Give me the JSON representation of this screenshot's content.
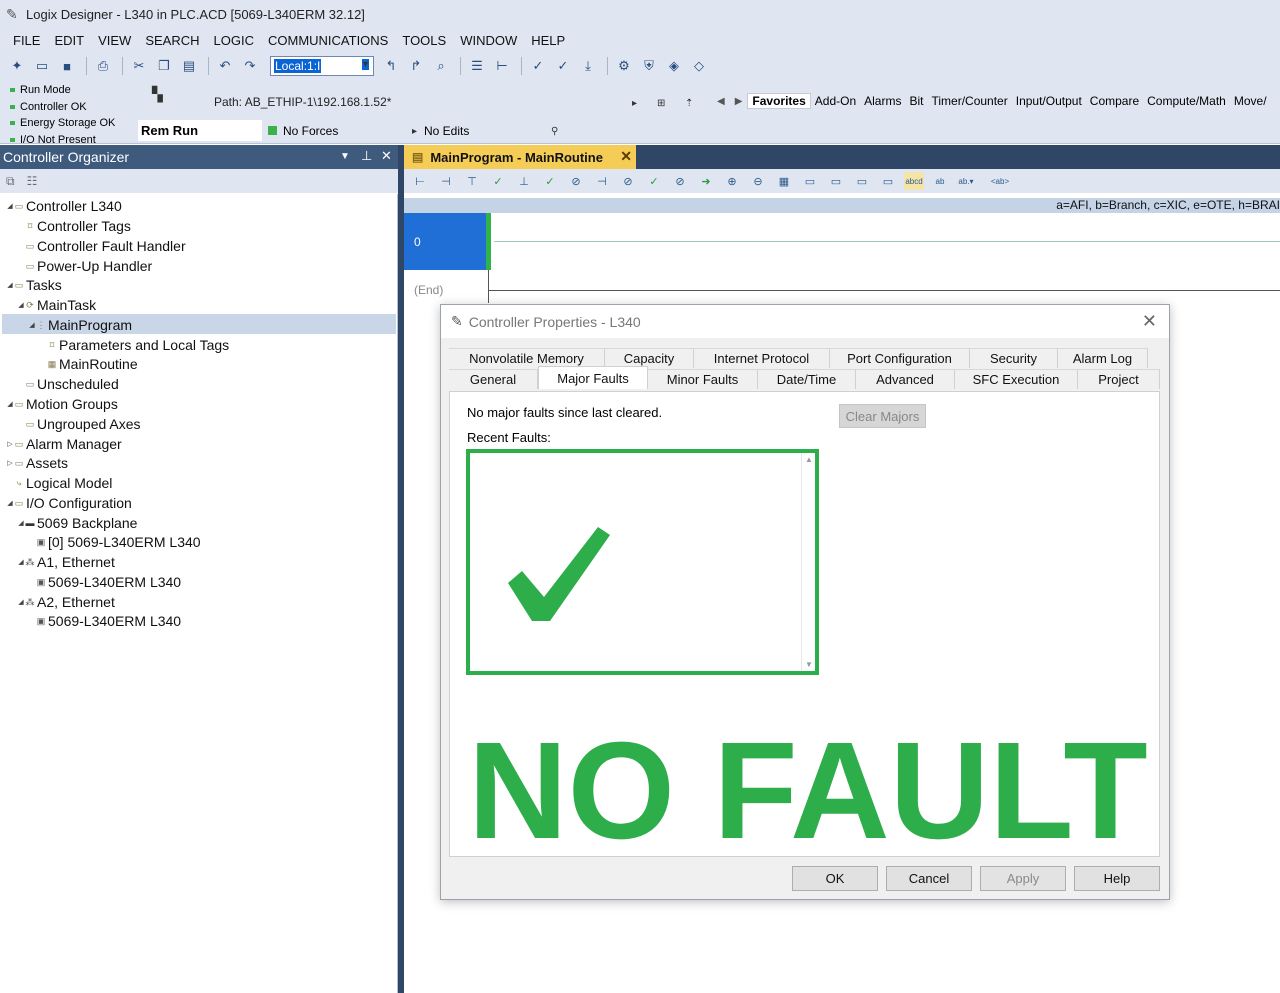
{
  "window": {
    "title": "Logix Designer - L340 in PLC.ACD [5069-L340ERM 32.12]"
  },
  "menu": [
    "FILE",
    "EDIT",
    "VIEW",
    "SEARCH",
    "LOGIC",
    "COMMUNICATIONS",
    "TOOLS",
    "WINDOW",
    "HELP"
  ],
  "toolbar": {
    "path_value": "Local:1:I"
  },
  "status": {
    "lines": [
      "Run Mode",
      "Controller OK",
      "Energy Storage OK",
      "I/O Not Present"
    ],
    "path": "Path: AB_ETHIP-1\\192.168.1.52*",
    "mode": "Rem Run",
    "forces": "No Forces",
    "edits": "No Edits"
  },
  "instruction_tabs": [
    "Favorites",
    "Add-On",
    "Alarms",
    "Bit",
    "Timer/Counter",
    "Input/Output",
    "Compare",
    "Compute/Math",
    "Move/"
  ],
  "organizer": {
    "title": "Controller Organizer",
    "items": [
      {
        "label": "Controller L340"
      },
      {
        "label": "Controller Tags"
      },
      {
        "label": "Controller Fault Handler"
      },
      {
        "label": "Power-Up Handler"
      },
      {
        "label": "Tasks"
      },
      {
        "label": "MainTask"
      },
      {
        "label": "MainProgram"
      },
      {
        "label": "Parameters and Local Tags"
      },
      {
        "label": "MainRoutine"
      },
      {
        "label": "Unscheduled"
      },
      {
        "label": "Motion Groups"
      },
      {
        "label": "Ungrouped Axes"
      },
      {
        "label": "Alarm Manager"
      },
      {
        "label": "Assets"
      },
      {
        "label": "Logical Model"
      },
      {
        "label": "I/O Configuration"
      },
      {
        "label": "5069 Backplane"
      },
      {
        "label": "[0] 5069-L340ERM L340"
      },
      {
        "label": "A1, Ethernet"
      },
      {
        "label": "5069-L340ERM L340"
      },
      {
        "label": "A2, Ethernet"
      },
      {
        "label": "5069-L340ERM L340"
      }
    ]
  },
  "routine": {
    "tab_title": "MainProgram - MainRoutine",
    "legend": "a=AFI, b=Branch, c=XIC, e=OTE, h=BRAI",
    "rung_number": "0",
    "end_label": "(End)"
  },
  "dialog": {
    "title": "Controller Properties - L340",
    "tabs_row1": [
      "Nonvolatile Memory",
      "Capacity",
      "Internet Protocol",
      "Port Configuration",
      "Security",
      "Alarm Log"
    ],
    "tabs_row2": [
      "General",
      "Major Faults",
      "Minor Faults",
      "Date/Time",
      "Advanced",
      "SFC Execution",
      "Project"
    ],
    "active_tab": "Major Faults",
    "message": "No major faults since last cleared.",
    "clear_button": "Clear Majors",
    "recent_label": "Recent Faults:",
    "overlay_text": "NO FAULT",
    "buttons": {
      "ok": "OK",
      "cancel": "Cancel",
      "apply": "Apply",
      "help": "Help"
    }
  },
  "colors": {
    "accent_green": "#2ead4b",
    "organizer_header": "#3e5a7d",
    "routine_tab": "#f5cc56",
    "rung_selected": "#1f6fd6"
  }
}
